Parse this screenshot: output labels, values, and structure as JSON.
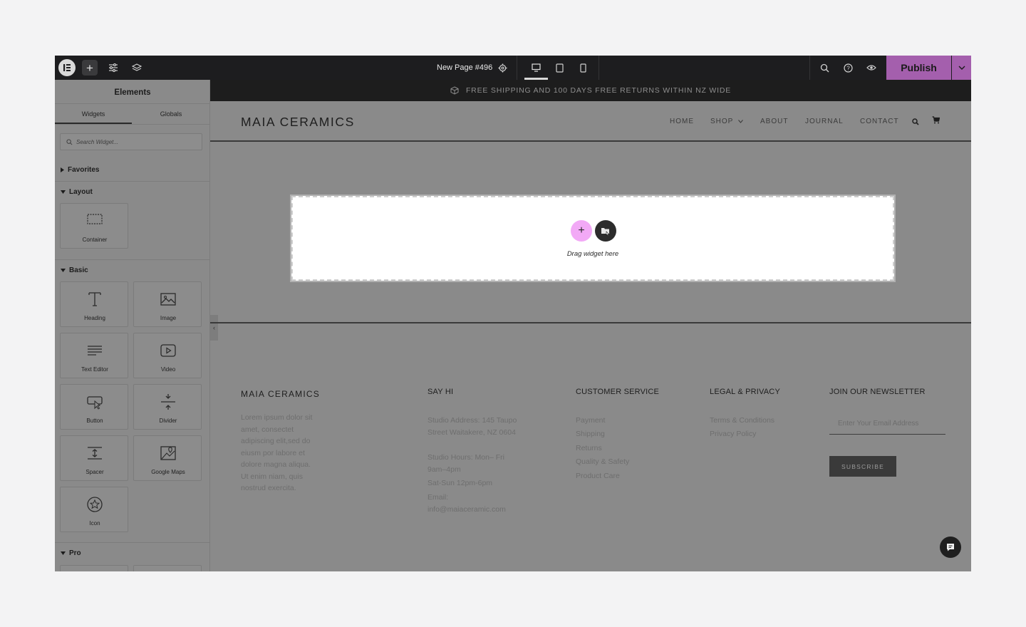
{
  "topbar": {
    "page_title": "New Page #496",
    "publish_label": "Publish"
  },
  "panel": {
    "title": "Elements",
    "tabs": [
      {
        "label": "Widgets"
      },
      {
        "label": "Globals"
      }
    ],
    "search_placeholder": "Search Widget...",
    "categories": {
      "favorites": "Favorites",
      "layout": "Layout",
      "basic": "Basic",
      "pro": "Pro"
    },
    "layout_widgets": [
      {
        "label": "Container",
        "icon": "container-icon"
      }
    ],
    "basic_widgets": [
      {
        "label": "Heading",
        "icon": "heading-icon"
      },
      {
        "label": "Image",
        "icon": "image-icon"
      },
      {
        "label": "Text Editor",
        "icon": "text-editor-icon"
      },
      {
        "label": "Video",
        "icon": "video-icon"
      },
      {
        "label": "Button",
        "icon": "button-icon"
      },
      {
        "label": "Divider",
        "icon": "divider-icon"
      },
      {
        "label": "Spacer",
        "icon": "spacer-icon"
      },
      {
        "label": "Google Maps",
        "icon": "map-icon"
      },
      {
        "label": "Icon",
        "icon": "star-icon"
      }
    ]
  },
  "site": {
    "announcement": "FREE SHIPPING AND 100 DAYS FREE RETURNS WITHIN NZ WIDE",
    "brand": "MAIA CERAMICS",
    "nav": [
      {
        "label": "HOME"
      },
      {
        "label": "SHOP"
      },
      {
        "label": "ABOUT"
      },
      {
        "label": "JOURNAL"
      },
      {
        "label": "CONTACT"
      }
    ],
    "drop_text": "Drag widget here"
  },
  "footer": {
    "brand": "MAIA CERAMICS",
    "about": "Lorem ipsum dolor sit amet, consectet adipiscing elit,sed do eiusm por labore et dolore magna aliqua. Ut enim niam, quis nostrud exercita.",
    "say_hi": {
      "heading": "SAY HI",
      "lines": [
        "Studio Address: 145 Taupo Street Waitakere, NZ 0604",
        "Studio Hours: Mon– Fri 9am–4pm",
        "Sat-Sun 12pm-6pm",
        "Email: info@maiaceramic.com"
      ]
    },
    "customer_service": {
      "heading": "CUSTOMER SERVICE",
      "links": [
        "Payment",
        "Shipping",
        "Returns",
        "Quality & Safety",
        "Product Care"
      ]
    },
    "legal": {
      "heading": "LEGAL & PRIVACY",
      "links": [
        "Terms & Conditions",
        "Privacy Policy"
      ]
    },
    "newsletter": {
      "heading": "JOIN OUR NEWSLETTER",
      "placeholder": "Enter Your Email Address",
      "button": "SUBSCRIBE"
    }
  },
  "colors": {
    "accent": "#a45fad",
    "topbar_bg": "#1d1d1f",
    "overlay": "#8a8a8a"
  }
}
